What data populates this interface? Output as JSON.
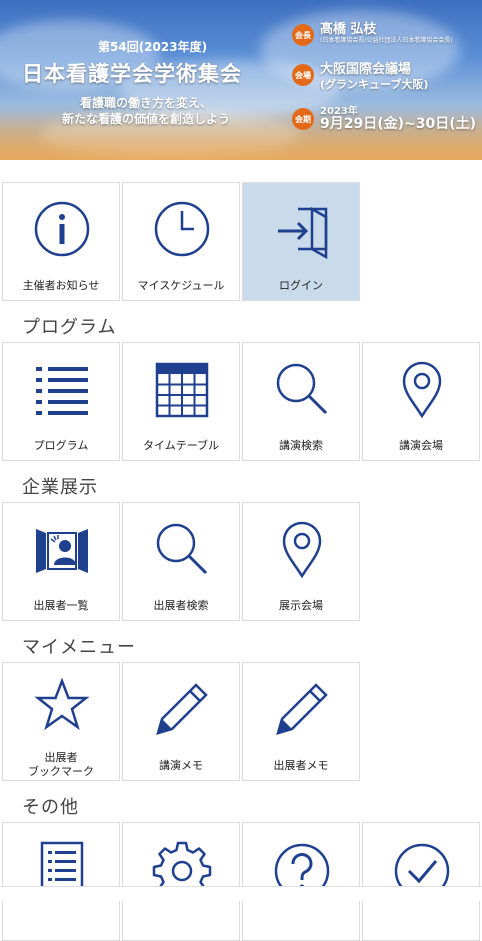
{
  "banner": {
    "edition": "第54回(2023年度)",
    "title": "日本看護学会学術集会",
    "theme_line1": "看護職の働き方を変え、",
    "theme_line2": "新たな看護の価値を創造しよう",
    "chair_badge": "会長",
    "chair_name": "髙橋 弘枝",
    "chair_affil": "(日本看護協会長/公益社団法人日本看護協会会長)",
    "venue_badge": "会場",
    "venue_name": "大阪国際会議場",
    "venue_sub": "(グランキューブ大阪)",
    "date_badge": "会期",
    "date_year": "2023年",
    "date_range": "9月29日(金)~30日(土)"
  },
  "top_tiles": [
    {
      "label": "主催者お知らせ"
    },
    {
      "label": "マイスケジュール"
    },
    {
      "label": "ログイン"
    }
  ],
  "sections": {
    "program": {
      "title": "プログラム",
      "tiles": [
        {
          "label": "プログラム"
        },
        {
          "label": "タイムテーブル"
        },
        {
          "label": "講演検索"
        },
        {
          "label": "講演会場"
        }
      ]
    },
    "exhibition": {
      "title": "企業展示",
      "tiles": [
        {
          "label": "出展者一覧"
        },
        {
          "label": "出展者検索"
        },
        {
          "label": "展示会場"
        }
      ]
    },
    "mymenu": {
      "title": "マイメニュー",
      "tiles": [
        {
          "label_line1": "出展者",
          "label_line2": "ブックマーク"
        },
        {
          "label": "講演メモ"
        },
        {
          "label": "出展者メモ"
        }
      ]
    },
    "other": {
      "title": "その他"
    }
  },
  "colors": {
    "icon": "#1f3f8f",
    "active_tile": "#c9daea"
  }
}
